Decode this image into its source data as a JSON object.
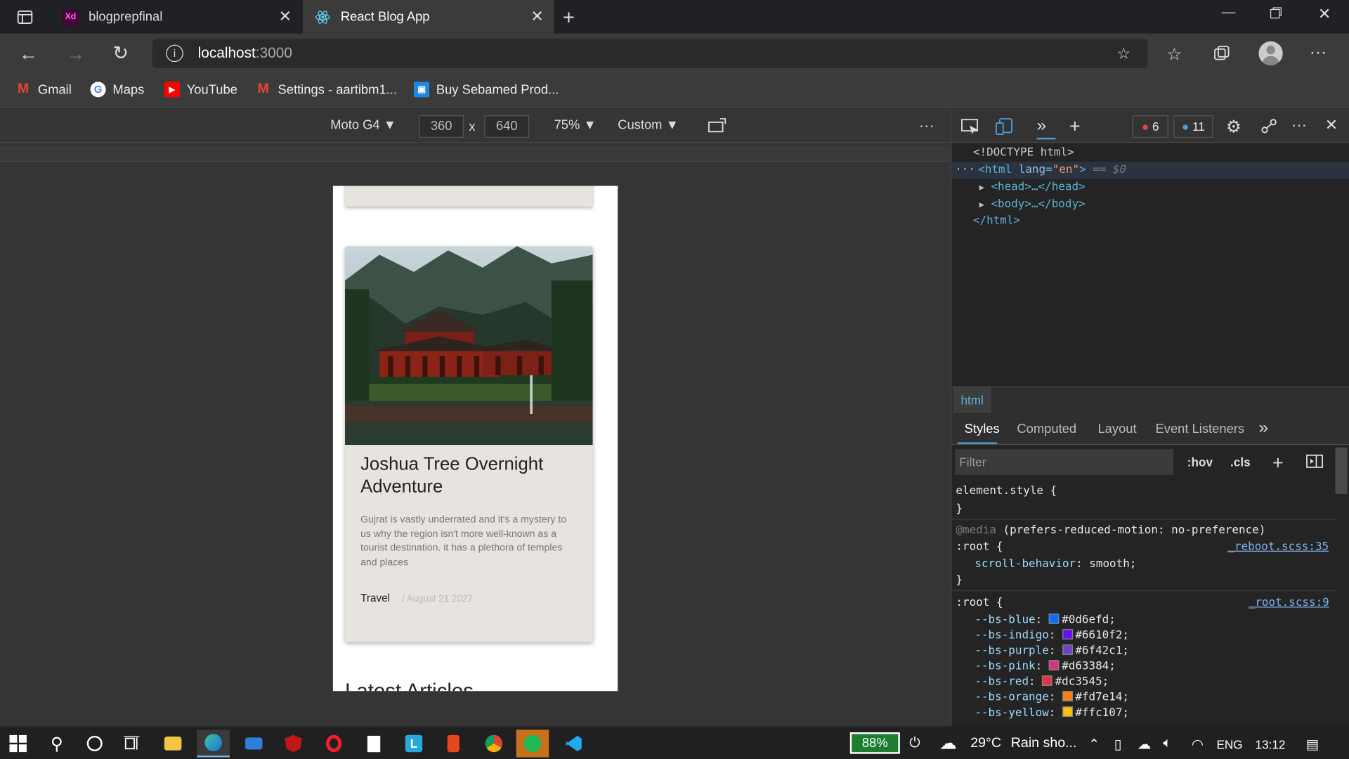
{
  "tabs": [
    {
      "label": "blogprepfinal",
      "icon": "xd-icon"
    },
    {
      "label": "React Blog App",
      "icon": "react-icon"
    }
  ],
  "address": {
    "host": "localhost",
    "port": ":3000"
  },
  "bookmarks": [
    "Gmail",
    "Maps",
    "YouTube",
    "Settings - aartibm1...",
    "Buy Sebamed Prod..."
  ],
  "device": {
    "name": "Moto G4",
    "width": "360",
    "height": "640",
    "zoom": "75%",
    "throttle": "Custom"
  },
  "page": {
    "card_title": "Joshua Tree Overnight Adventure",
    "card_text": "Gujrat is vastly underrated and it's a mystery to us why the region isn't more well-known as a tourist destination. it has a plethora of temples and places",
    "category": "Travel",
    "date": "/ August 21 2027",
    "section_heading": "Latest Articles"
  },
  "devtools": {
    "errors": "6",
    "messages": "11",
    "breadcrumb": "html",
    "subtabs": [
      "Styles",
      "Computed",
      "Layout",
      "Event Listeners"
    ],
    "filter_placeholder": "Filter",
    "hov": ":hov",
    "cls": ".cls",
    "dom": {
      "doctype": "<!DOCTYPE html>",
      "html_open": "<html",
      "lang_attr": "lang",
      "lang_val": "\"en\"",
      "html_gt": ">",
      "eq": "== $0",
      "head": "<head>…</head>",
      "body": "<body>…</body>",
      "html_close": "</html>"
    },
    "styles": {
      "element_style": "element.style {",
      "brace_close": "}",
      "media_kw": "@media",
      "media_q": "(prefers-reduced-motion: no-preference)",
      "root_sel": ":root {",
      "reboot_link": "_reboot.scss:35",
      "scroll_prop": "scroll-behavior",
      "scroll_val": "smooth;",
      "root_link": "_root.scss:9",
      "vars": [
        {
          "name": "--bs-blue",
          "value": "#0d6efd;",
          "color": "#0d6efd"
        },
        {
          "name": "--bs-indigo",
          "value": "#6610f2;",
          "color": "#6610f2"
        },
        {
          "name": "--bs-purple",
          "value": "#6f42c1;",
          "color": "#6f42c1"
        },
        {
          "name": "--bs-pink",
          "value": "#d63384;",
          "color": "#d63384"
        },
        {
          "name": "--bs-red",
          "value": "#dc3545;",
          "color": "#dc3545"
        },
        {
          "name": "--bs-orange",
          "value": "#fd7e14;",
          "color": "#fd7e14"
        },
        {
          "name": "--bs-yellow",
          "value": "#ffc107;",
          "color": "#ffc107"
        }
      ]
    }
  },
  "taskbar": {
    "battery": "88%",
    "weather": "29°C",
    "weather_text": "Rain sho...",
    "lang": "ENG",
    "time": "13:12"
  }
}
